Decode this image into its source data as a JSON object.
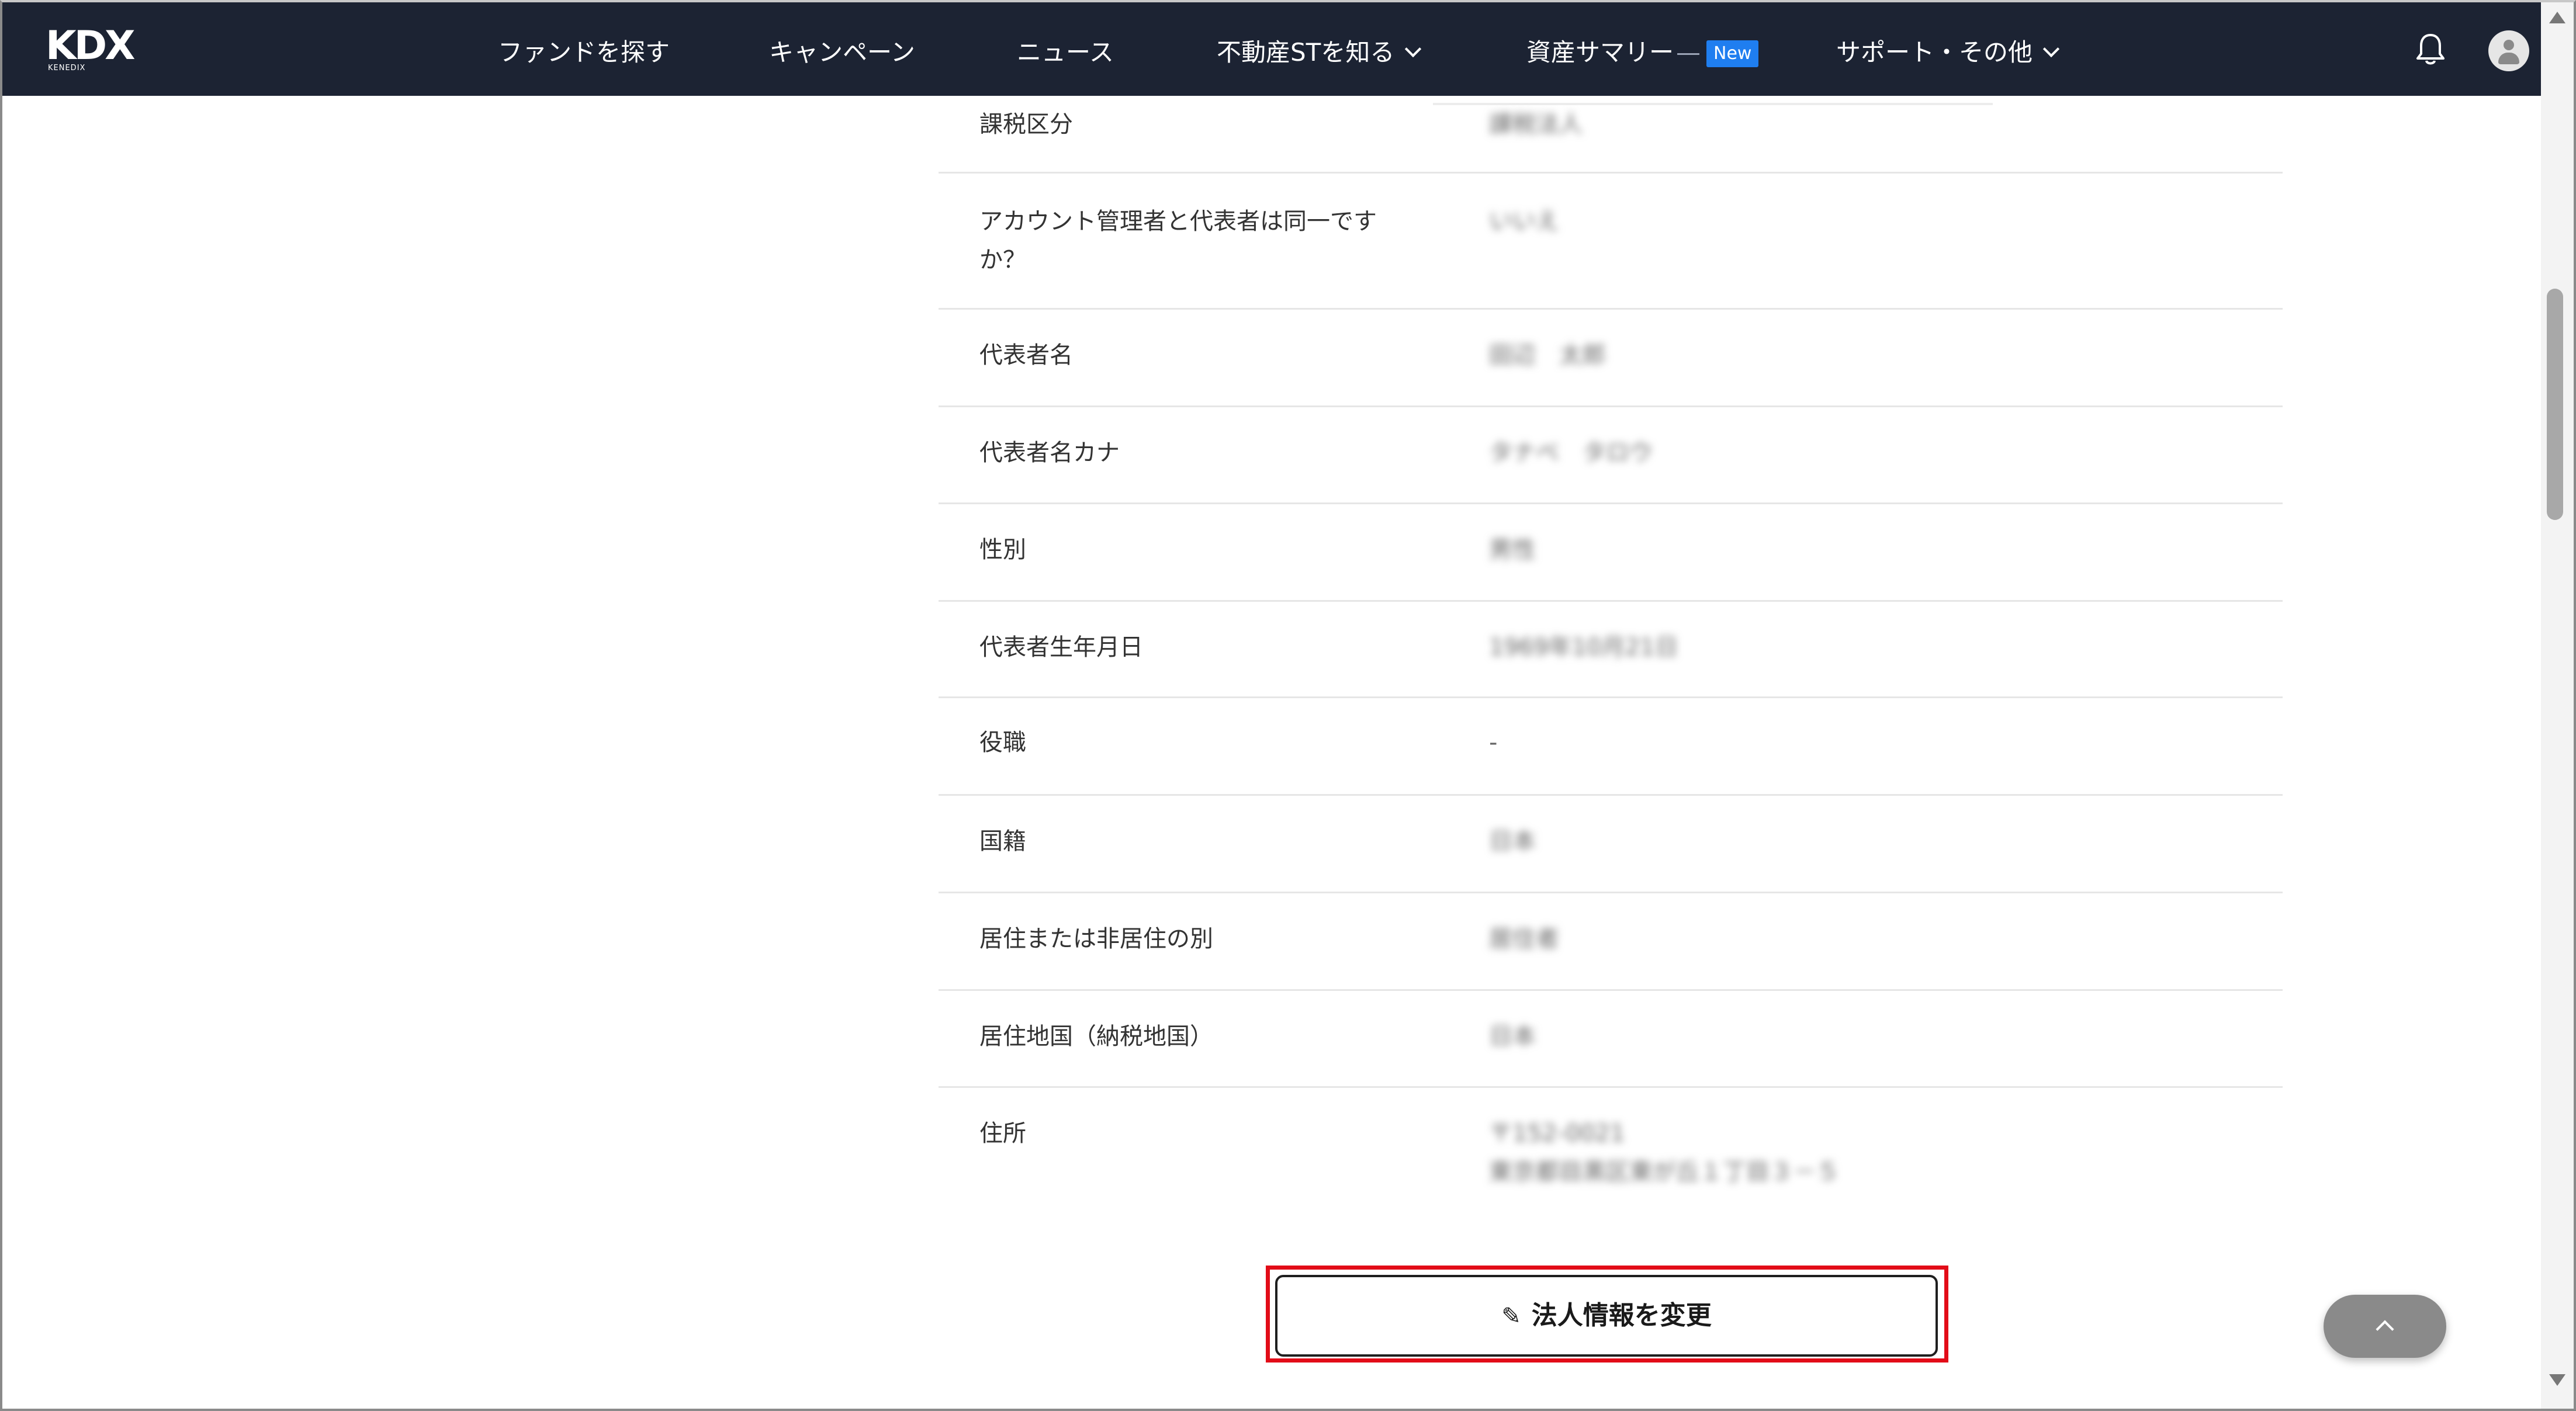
{
  "header": {
    "logo_main": "KDX",
    "logo_sub": "KENEDIX",
    "nav": [
      {
        "label": "ファンドを探す"
      },
      {
        "label": "キャンペーン"
      },
      {
        "label": "ニュース"
      },
      {
        "label": "不動産STを知る"
      },
      {
        "label": "資産サマリー",
        "badge": "New"
      },
      {
        "label": "サポート・その他"
      }
    ],
    "icons": {
      "bell": "bell-icon",
      "avatar": "user-avatar-icon"
    }
  },
  "rows": [
    {
      "label": "課税区分",
      "value": "課税法人"
    },
    {
      "label": "アカウント管理者と代表者は同一ですか？",
      "value": "いいえ"
    },
    {
      "label": "代表者名",
      "value": "田辺　太郎"
    },
    {
      "label": "代表者名カナ",
      "value": "タナベ　タロウ"
    },
    {
      "label": "性別",
      "value": "男性"
    },
    {
      "label": "代表者生年月日",
      "value": "1969年10月21日"
    },
    {
      "label": "役職",
      "value": "-"
    },
    {
      "label": "国籍",
      "value": "日本"
    },
    {
      "label": "居住または非居住の別",
      "value": "居住者"
    },
    {
      "label": "居住地国（納税地国）",
      "value": "日本"
    },
    {
      "label": "住所",
      "value": "〒152-0021",
      "value2": "東京都目黒区東が丘１丁目３－５"
    }
  ],
  "edit_button": {
    "label": "法人情報を変更",
    "icon": "pencil-icon"
  },
  "to_top": {
    "icon": "chevron-up-icon"
  },
  "colors": {
    "header_bg": "#1c2333",
    "badge_bg": "#1f7ef0",
    "highlight": "#e20c18"
  }
}
